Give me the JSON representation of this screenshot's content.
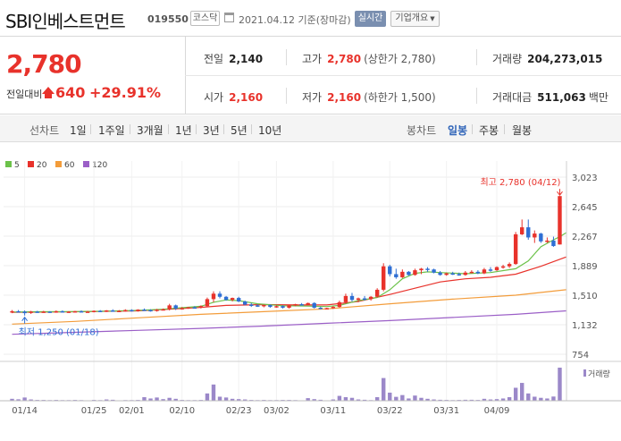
{
  "header": {
    "stock_name": "SBI인베스트먼트",
    "stock_code": "019550",
    "market_badge": "코스닥",
    "date_text": "2021.04.12 기준(장마감)",
    "realtime_button": "실시간",
    "overview_button": "기업개요"
  },
  "quote": {
    "price": "2,780",
    "change_label": "전일대비",
    "change_value": "640",
    "change_percent": "+29.91%",
    "prev_close_label": "전일",
    "prev_close": "2,140",
    "high_label": "고가",
    "high": "2,780",
    "upper_limit": "(상한가 2,780)",
    "volume_label": "거래량",
    "volume": "204,273,015",
    "open_label": "시가",
    "open": "2,160",
    "low_label": "저가",
    "low": "2,160",
    "lower_limit": "(하한가 1,500)",
    "amount_label": "거래대금",
    "amount": "511,063",
    "amount_unit": "백만"
  },
  "period_tabs": {
    "line_label": "선차트",
    "line_items": [
      "1일",
      "1주일",
      "3개월",
      "1년",
      "3년",
      "5년",
      "10년"
    ],
    "candle_label": "봉차트",
    "candle_items": [
      "일봉",
      "주봉",
      "월봉"
    ],
    "selected_candle": "일봉"
  },
  "colors": {
    "up": "#e8322b",
    "down": "#2f6fd4",
    "ma5": "#6cc24a",
    "ma20": "#e8322b",
    "ma60": "#f39c3a",
    "ma120": "#9b5fc7",
    "volume": "#9b88c9"
  },
  "chart_data": {
    "type": "candlestick",
    "legend": [
      "5",
      "20",
      "60",
      "120"
    ],
    "y_ticks": [
      3023,
      2645,
      2267,
      1889,
      1510,
      1132,
      754
    ],
    "ylim": [
      754,
      3023
    ],
    "x_tick_labels": [
      "01/14",
      "01/25",
      "02/01",
      "02/10",
      "02/23",
      "03/02",
      "03/11",
      "03/22",
      "03/31",
      "04/09"
    ],
    "high_annotation": "최고 2,780 (04/12)",
    "low_annotation": "최저 1,250 (01/18)",
    "volume_label": "거래량",
    "candles": [
      {
        "o": 1300,
        "h": 1320,
        "l": 1280,
        "c": 1305,
        "v": 12
      },
      {
        "o": 1305,
        "h": 1320,
        "l": 1290,
        "c": 1300,
        "v": 9
      },
      {
        "o": 1300,
        "h": 1315,
        "l": 1250,
        "c": 1280,
        "v": 20
      },
      {
        "o": 1285,
        "h": 1310,
        "l": 1270,
        "c": 1300,
        "v": 8
      },
      {
        "o": 1300,
        "h": 1310,
        "l": 1285,
        "c": 1295,
        "v": 5
      },
      {
        "o": 1295,
        "h": 1310,
        "l": 1285,
        "c": 1300,
        "v": 5
      },
      {
        "o": 1300,
        "h": 1305,
        "l": 1285,
        "c": 1295,
        "v": 4
      },
      {
        "o": 1295,
        "h": 1315,
        "l": 1285,
        "c": 1305,
        "v": 5
      },
      {
        "o": 1305,
        "h": 1315,
        "l": 1290,
        "c": 1295,
        "v": 4
      },
      {
        "o": 1295,
        "h": 1305,
        "l": 1285,
        "c": 1300,
        "v": 4
      },
      {
        "o": 1300,
        "h": 1310,
        "l": 1290,
        "c": 1305,
        "v": 5
      },
      {
        "o": 1305,
        "h": 1315,
        "l": 1295,
        "c": 1300,
        "v": 4
      },
      {
        "o": 1300,
        "h": 1310,
        "l": 1290,
        "c": 1300,
        "v": 3
      },
      {
        "o": 1300,
        "h": 1315,
        "l": 1290,
        "c": 1310,
        "v": 5
      },
      {
        "o": 1310,
        "h": 1320,
        "l": 1295,
        "c": 1300,
        "v": 4
      },
      {
        "o": 1300,
        "h": 1320,
        "l": 1295,
        "c": 1315,
        "v": 8
      },
      {
        "o": 1315,
        "h": 1330,
        "l": 1300,
        "c": 1305,
        "v": 6
      },
      {
        "o": 1305,
        "h": 1320,
        "l": 1295,
        "c": 1310,
        "v": 3
      },
      {
        "o": 1310,
        "h": 1330,
        "l": 1300,
        "c": 1320,
        "v": 4
      },
      {
        "o": 1320,
        "h": 1330,
        "l": 1300,
        "c": 1310,
        "v": 4
      },
      {
        "o": 1310,
        "h": 1330,
        "l": 1300,
        "c": 1325,
        "v": 5
      },
      {
        "o": 1325,
        "h": 1340,
        "l": 1310,
        "c": 1320,
        "v": 22
      },
      {
        "o": 1320,
        "h": 1330,
        "l": 1300,
        "c": 1315,
        "v": 14
      },
      {
        "o": 1315,
        "h": 1335,
        "l": 1300,
        "c": 1325,
        "v": 20
      },
      {
        "o": 1325,
        "h": 1340,
        "l": 1315,
        "c": 1330,
        "v": 10
      },
      {
        "o": 1330,
        "h": 1400,
        "l": 1315,
        "c": 1380,
        "v": 18
      },
      {
        "o": 1380,
        "h": 1390,
        "l": 1320,
        "c": 1340,
        "v": 12
      },
      {
        "o": 1340,
        "h": 1360,
        "l": 1325,
        "c": 1345,
        "v": 5
      },
      {
        "o": 1345,
        "h": 1360,
        "l": 1335,
        "c": 1355,
        "v": 4
      },
      {
        "o": 1355,
        "h": 1370,
        "l": 1340,
        "c": 1350,
        "v": 4
      },
      {
        "o": 1350,
        "h": 1380,
        "l": 1340,
        "c": 1370,
        "v": 5
      },
      {
        "o": 1370,
        "h": 1480,
        "l": 1360,
        "c": 1460,
        "v": 45
      },
      {
        "o": 1460,
        "h": 1560,
        "l": 1420,
        "c": 1530,
        "v": 100
      },
      {
        "o": 1530,
        "h": 1560,
        "l": 1470,
        "c": 1490,
        "v": 25
      },
      {
        "o": 1490,
        "h": 1500,
        "l": 1440,
        "c": 1450,
        "v": 20
      },
      {
        "o": 1450,
        "h": 1480,
        "l": 1430,
        "c": 1475,
        "v": 12
      },
      {
        "o": 1475,
        "h": 1490,
        "l": 1420,
        "c": 1430,
        "v": 10
      },
      {
        "o": 1430,
        "h": 1440,
        "l": 1380,
        "c": 1390,
        "v": 8
      },
      {
        "o": 1390,
        "h": 1410,
        "l": 1360,
        "c": 1380,
        "v": 5
      },
      {
        "o": 1380,
        "h": 1395,
        "l": 1360,
        "c": 1370,
        "v": 4
      },
      {
        "o": 1370,
        "h": 1390,
        "l": 1355,
        "c": 1385,
        "v": 5
      },
      {
        "o": 1385,
        "h": 1390,
        "l": 1350,
        "c": 1360,
        "v": 4
      },
      {
        "o": 1360,
        "h": 1380,
        "l": 1350,
        "c": 1370,
        "v": 4
      },
      {
        "o": 1370,
        "h": 1380,
        "l": 1340,
        "c": 1350,
        "v": 5
      },
      {
        "o": 1350,
        "h": 1385,
        "l": 1340,
        "c": 1380,
        "v": 5
      },
      {
        "o": 1380,
        "h": 1400,
        "l": 1370,
        "c": 1395,
        "v": 4
      },
      {
        "o": 1395,
        "h": 1410,
        "l": 1380,
        "c": 1390,
        "v": 3
      },
      {
        "o": 1390,
        "h": 1415,
        "l": 1380,
        "c": 1410,
        "v": 16
      },
      {
        "o": 1410,
        "h": 1420,
        "l": 1340,
        "c": 1350,
        "v": 10
      },
      {
        "o": 1350,
        "h": 1360,
        "l": 1330,
        "c": 1340,
        "v": 6
      },
      {
        "o": 1340,
        "h": 1350,
        "l": 1330,
        "c": 1345,
        "v": 3
      },
      {
        "o": 1345,
        "h": 1370,
        "l": 1335,
        "c": 1360,
        "v": 8
      },
      {
        "o": 1360,
        "h": 1440,
        "l": 1350,
        "c": 1420,
        "v": 30
      },
      {
        "o": 1420,
        "h": 1530,
        "l": 1400,
        "c": 1500,
        "v": 22
      },
      {
        "o": 1500,
        "h": 1540,
        "l": 1430,
        "c": 1450,
        "v": 18
      },
      {
        "o": 1450,
        "h": 1480,
        "l": 1420,
        "c": 1470,
        "v": 8
      },
      {
        "o": 1470,
        "h": 1500,
        "l": 1440,
        "c": 1460,
        "v": 6
      },
      {
        "o": 1460,
        "h": 1500,
        "l": 1440,
        "c": 1490,
        "v": 4
      },
      {
        "o": 1490,
        "h": 1600,
        "l": 1480,
        "c": 1580,
        "v": 22
      },
      {
        "o": 1580,
        "h": 1920,
        "l": 1560,
        "c": 1880,
        "v": 140
      },
      {
        "o": 1880,
        "h": 1900,
        "l": 1750,
        "c": 1780,
        "v": 50
      },
      {
        "o": 1780,
        "h": 1850,
        "l": 1720,
        "c": 1740,
        "v": 24
      },
      {
        "o": 1740,
        "h": 1840,
        "l": 1730,
        "c": 1810,
        "v": 35
      },
      {
        "o": 1810,
        "h": 1820,
        "l": 1760,
        "c": 1770,
        "v": 14
      },
      {
        "o": 1770,
        "h": 1850,
        "l": 1760,
        "c": 1830,
        "v": 32
      },
      {
        "o": 1830,
        "h": 1860,
        "l": 1780,
        "c": 1850,
        "v": 18
      },
      {
        "o": 1850,
        "h": 1870,
        "l": 1810,
        "c": 1840,
        "v": 12
      },
      {
        "o": 1840,
        "h": 1850,
        "l": 1790,
        "c": 1800,
        "v": 8
      },
      {
        "o": 1800,
        "h": 1820,
        "l": 1760,
        "c": 1770,
        "v": 6
      },
      {
        "o": 1770,
        "h": 1800,
        "l": 1760,
        "c": 1790,
        "v": 5
      },
      {
        "o": 1790,
        "h": 1810,
        "l": 1770,
        "c": 1780,
        "v": 4
      },
      {
        "o": 1780,
        "h": 1800,
        "l": 1760,
        "c": 1770,
        "v": 5
      },
      {
        "o": 1770,
        "h": 1820,
        "l": 1760,
        "c": 1800,
        "v": 6
      },
      {
        "o": 1800,
        "h": 1830,
        "l": 1790,
        "c": 1810,
        "v": 6
      },
      {
        "o": 1810,
        "h": 1830,
        "l": 1780,
        "c": 1790,
        "v": 5
      },
      {
        "o": 1790,
        "h": 1860,
        "l": 1780,
        "c": 1840,
        "v": 12
      },
      {
        "o": 1840,
        "h": 1870,
        "l": 1810,
        "c": 1830,
        "v": 8
      },
      {
        "o": 1830,
        "h": 1880,
        "l": 1820,
        "c": 1870,
        "v": 10
      },
      {
        "o": 1870,
        "h": 1900,
        "l": 1850,
        "c": 1880,
        "v": 14
      },
      {
        "o": 1880,
        "h": 1930,
        "l": 1860,
        "c": 1910,
        "v": 22
      },
      {
        "o": 1910,
        "h": 2320,
        "l": 1900,
        "c": 2290,
        "v": 80
      },
      {
        "o": 2290,
        "h": 2480,
        "l": 2280,
        "c": 2380,
        "v": 110
      },
      {
        "o": 2380,
        "h": 2480,
        "l": 2220,
        "c": 2250,
        "v": 45
      },
      {
        "o": 2250,
        "h": 2340,
        "l": 2180,
        "c": 2300,
        "v": 25
      },
      {
        "o": 2300,
        "h": 2310,
        "l": 2180,
        "c": 2200,
        "v": 18
      },
      {
        "o": 2200,
        "h": 2250,
        "l": 2180,
        "c": 2210,
        "v": 14
      },
      {
        "o": 2210,
        "h": 2260,
        "l": 2130,
        "c": 2140,
        "v": 26
      },
      {
        "o": 2160,
        "h": 2780,
        "l": 2160,
        "c": 2780,
        "v": 204
      }
    ],
    "ma5": [
      [
        0,
        1295
      ],
      [
        4,
        1298
      ],
      [
        10,
        1300
      ],
      [
        15,
        1305
      ],
      [
        20,
        1315
      ],
      [
        24,
        1330
      ],
      [
        27,
        1350
      ],
      [
        30,
        1368
      ],
      [
        32,
        1420
      ],
      [
        34,
        1450
      ],
      [
        36,
        1440
      ],
      [
        39,
        1400
      ],
      [
        43,
        1375
      ],
      [
        47,
        1370
      ],
      [
        50,
        1365
      ],
      [
        52,
        1380
      ],
      [
        55,
        1440
      ],
      [
        58,
        1480
      ],
      [
        60,
        1580
      ],
      [
        62,
        1720
      ],
      [
        64,
        1790
      ],
      [
        66,
        1810
      ],
      [
        68,
        1800
      ],
      [
        72,
        1785
      ],
      [
        76,
        1800
      ],
      [
        80,
        1850
      ],
      [
        82,
        1950
      ],
      [
        84,
        2130
      ],
      [
        86,
        2220
      ],
      [
        87,
        2260
      ],
      [
        88,
        2310
      ]
    ],
    "ma20": [
      [
        0,
        1290
      ],
      [
        10,
        1298
      ],
      [
        20,
        1310
      ],
      [
        25,
        1330
      ],
      [
        30,
        1355
      ],
      [
        34,
        1380
      ],
      [
        40,
        1390
      ],
      [
        45,
        1385
      ],
      [
        50,
        1385
      ],
      [
        55,
        1430
      ],
      [
        60,
        1520
      ],
      [
        64,
        1600
      ],
      [
        68,
        1680
      ],
      [
        72,
        1720
      ],
      [
        76,
        1740
      ],
      [
        80,
        1780
      ],
      [
        84,
        1880
      ],
      [
        88,
        2000
      ]
    ],
    "ma60": [
      [
        0,
        1140
      ],
      [
        10,
        1175
      ],
      [
        20,
        1220
      ],
      [
        30,
        1265
      ],
      [
        40,
        1300
      ],
      [
        50,
        1335
      ],
      [
        60,
        1400
      ],
      [
        70,
        1460
      ],
      [
        80,
        1510
      ],
      [
        88,
        1580
      ]
    ],
    "ma120": [
      [
        0,
        1010
      ],
      [
        10,
        1035
      ],
      [
        20,
        1060
      ],
      [
        30,
        1085
      ],
      [
        40,
        1115
      ],
      [
        50,
        1150
      ],
      [
        60,
        1185
      ],
      [
        70,
        1225
      ],
      [
        80,
        1265
      ],
      [
        88,
        1310
      ]
    ]
  }
}
